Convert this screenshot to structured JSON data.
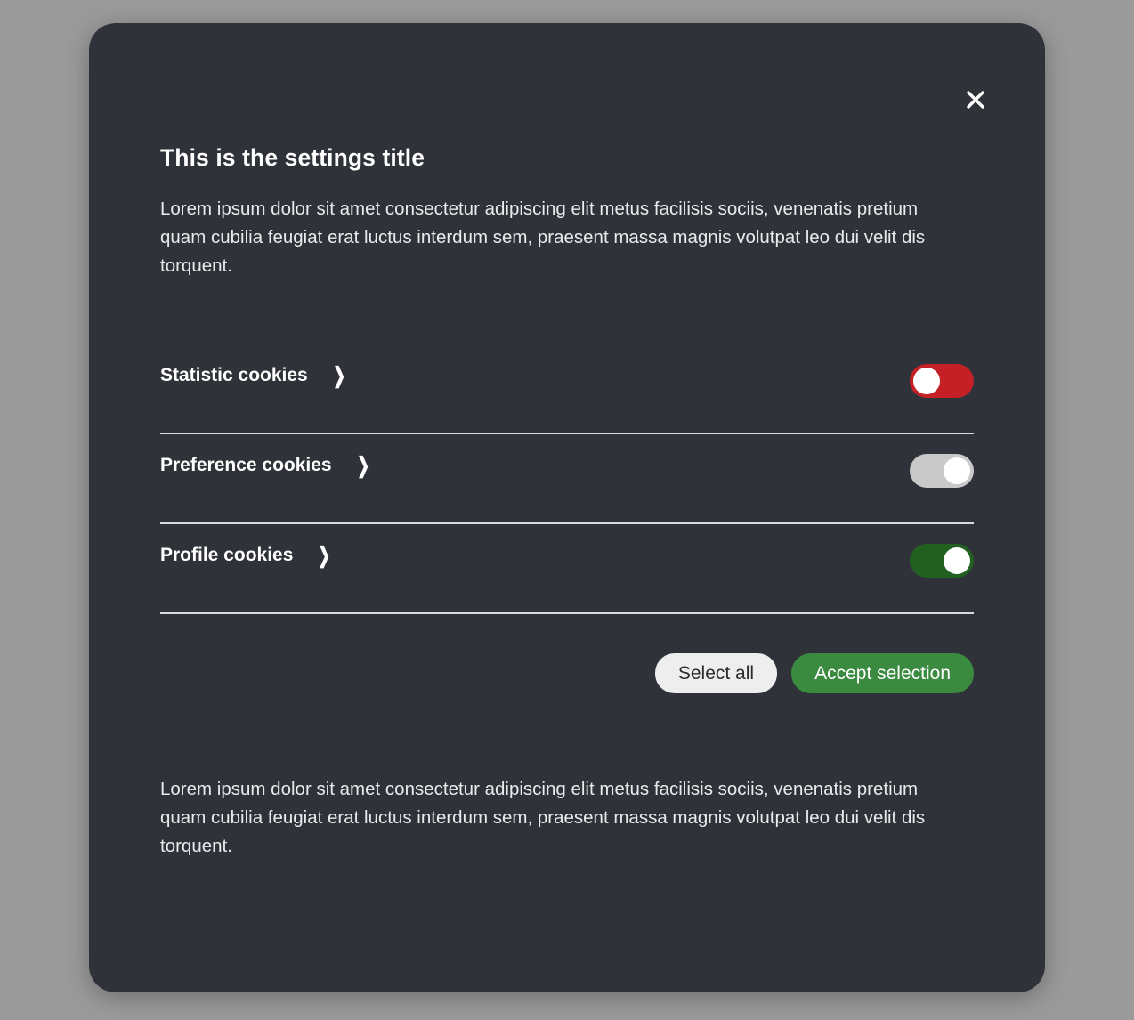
{
  "dialog": {
    "title": "This is the settings title",
    "intro": "Lorem ipsum dolor sit amet consectetur adipiscing elit metus facilisis sociis, venenatis pretium quam cubilia feugiat erat luctus interdum sem, praesent massa magnis volutpat leo dui velit dis torquent.",
    "footer": "Lorem ipsum dolor sit amet consectetur adipiscing elit metus facilisis sociis, venenatis pretium quam cubilia feugiat erat luctus interdum sem, praesent massa magnis volutpat leo dui velit dis torquent.",
    "close_icon": "close-icon",
    "close_label": "✕",
    "background": "#2f3238",
    "page_background": "#9a9a9a"
  },
  "rows": [
    {
      "label": "Statistic cookies",
      "expand_icon": "chevron-right-icon",
      "expand_glyph": "❯",
      "toggle_state": "off",
      "toggle_color": "#c42026"
    },
    {
      "label": "Preference cookies",
      "expand_icon": "chevron-right-icon",
      "expand_glyph": "❯",
      "toggle_state": "on",
      "toggle_color": "#c9c9c9"
    },
    {
      "label": "Profile cookies",
      "expand_icon": "chevron-right-icon",
      "expand_glyph": "❯",
      "toggle_state": "on",
      "toggle_color": "#226022"
    }
  ],
  "actions": {
    "select_all_label": "Select all",
    "accept_selection_label": "Accept selection",
    "select_all_color": "#eeeeee",
    "accept_selection_color": "#3a8a40"
  }
}
